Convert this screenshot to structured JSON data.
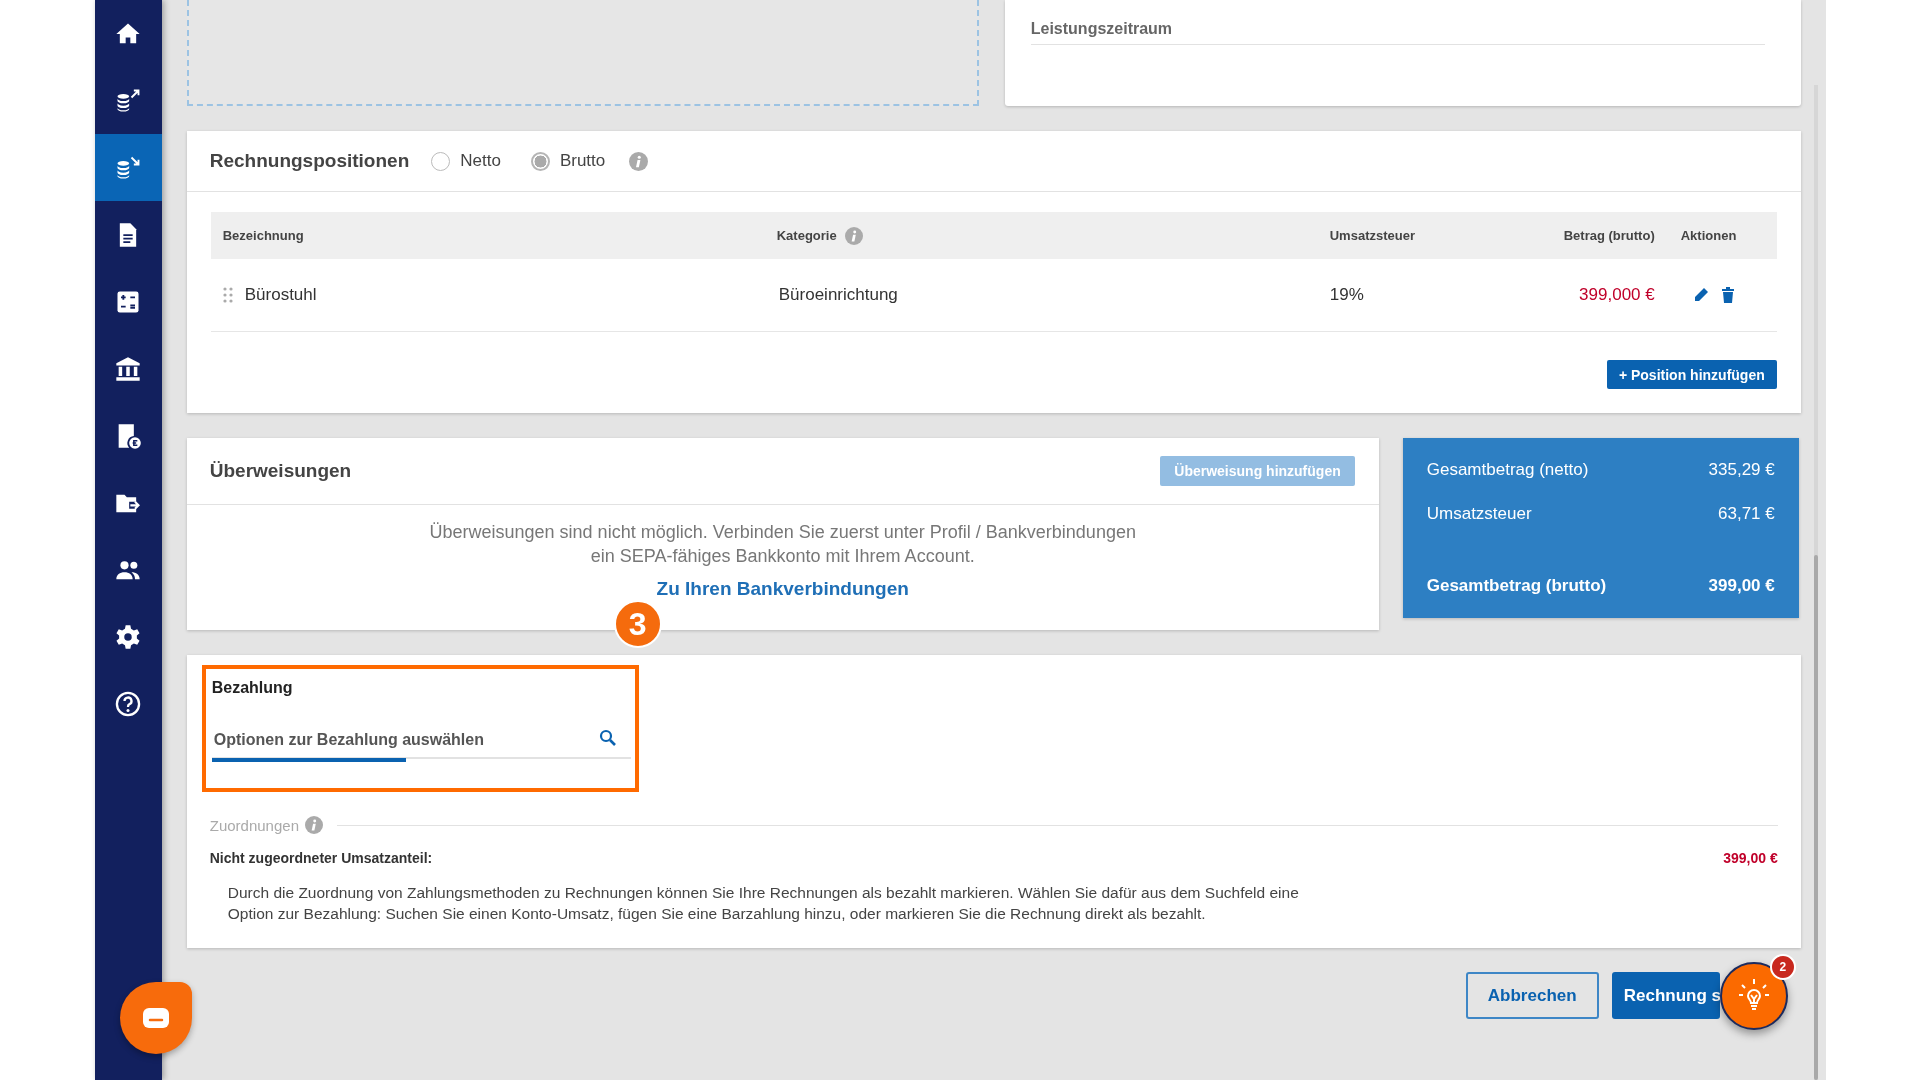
{
  "sidebar": {
    "items": [
      {
        "selected": false
      },
      {
        "selected": false
      },
      {
        "selected": true
      },
      {
        "selected": false
      },
      {
        "selected": false
      },
      {
        "selected": false
      },
      {
        "selected": false
      },
      {
        "selected": false
      },
      {
        "selected": false
      },
      {
        "selected": false
      },
      {
        "selected": false
      }
    ]
  },
  "service_period": {
    "label": "Leistungszeitraum"
  },
  "positions": {
    "title": "Rechnungspositionen",
    "price_mode": [
      {
        "label": "Netto",
        "selected": false
      },
      {
        "label": "Brutto",
        "selected": true
      }
    ],
    "columns": [
      "Bezeichnung",
      "Kategorie",
      "Umsatzsteuer",
      "Betrag (brutto)",
      "Aktionen"
    ],
    "rows": [
      {
        "name": "Bürostuhl",
        "category": "Büroeinrichtung",
        "vat": "19%",
        "amount": "399,000 €"
      }
    ],
    "add_button": "+ Position hinzufügen"
  },
  "transfers": {
    "title": "Überweisungen",
    "add_button": {
      "label": "Überweisung hinzufügen",
      "disabled": true
    },
    "message_lines": [
      "Überweisungen sind nicht möglich. Verbinden Sie zuerst unter Profil / Bankverbindungen",
      "ein SEPA-fähiges Bankkonto mit Ihrem Account."
    ],
    "link": "Zu Ihren Bankverbindungen"
  },
  "step_marker": "3",
  "summary": [
    {
      "label": "Gesamtbetrag (netto)",
      "value": "335,29 €",
      "total": false
    },
    {
      "label": "Umsatzsteuer",
      "value": "63,71 €",
      "total": false
    },
    {
      "label": "Gesamtbetrag (brutto)",
      "value": "399,00 €",
      "total": true
    }
  ],
  "payment": {
    "title": "Bezahlung",
    "highlighted": true,
    "field": {
      "placeholder": "Optionen zur Bezahlung auswählen",
      "focused": true
    },
    "assignments_label": "Zuordnungen",
    "unassigned_label": "Nicht zugeordneter Umsatzanteil:",
    "unassigned_amount": "399,00 €",
    "help_text": "Durch die Zuordnung von Zahlungsmethoden zu Rechnungen können Sie Ihre Rechnungen als bezahlt markieren. Wählen Sie dafür aus dem Suchfeld eine Option zur Bezahlung: Suchen Sie einen Konto-Umsatz, fügen Sie eine Barzahlung hinzu, oder markieren Sie die Rechnung direkt als bezahlt."
  },
  "buttons": [
    {
      "label": "Abbrechen",
      "kind": "secondary"
    },
    {
      "label": "Rechnung s",
      "kind": "primary"
    }
  ],
  "tips_badge": "2"
}
